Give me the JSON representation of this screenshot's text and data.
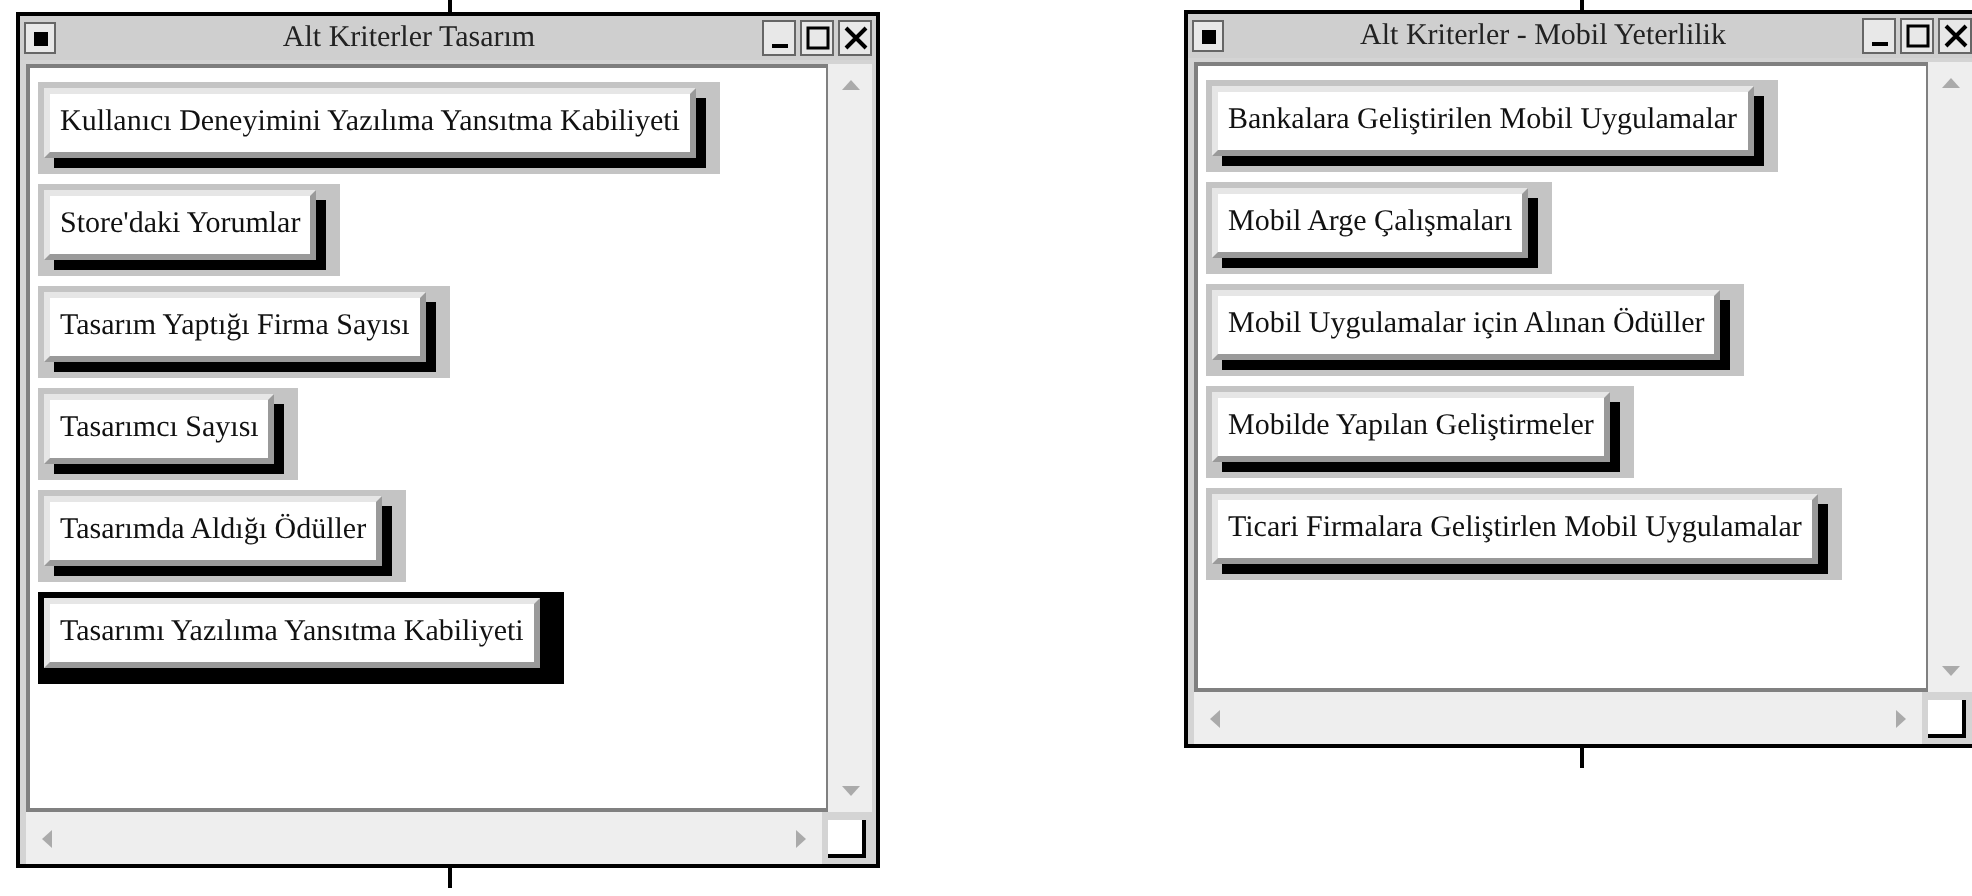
{
  "windows": [
    {
      "title": "Alt Kriterler Tasarım",
      "items": [
        {
          "label": "Kullanıcı Deneyimini Yazılıma Yansıtma Kabiliyeti",
          "selected": false
        },
        {
          "label": "Store'daki Yorumlar",
          "selected": false
        },
        {
          "label": "Tasarım Yaptığı Firma Sayısı",
          "selected": false
        },
        {
          "label": "Tasarımcı Sayısı",
          "selected": false
        },
        {
          "label": "Tasarımda Aldığı Ödüller",
          "selected": false
        },
        {
          "label": "Tasarımı Yazılıma Yansıtma Kabiliyeti",
          "selected": true
        }
      ]
    },
    {
      "title": "Alt Kriterler - Mobil Yeterlilik",
      "items": [
        {
          "label": "Bankalara Geliştirilen Mobil Uygulamalar",
          "selected": false
        },
        {
          "label": "Mobil Arge Çalışmaları",
          "selected": false
        },
        {
          "label": "Mobil Uygulamalar için Alınan Ödüller",
          "selected": false
        },
        {
          "label": "Mobilde Yapılan Geliştirmeler",
          "selected": false
        },
        {
          "label": "Ticari Firmalara Geliştirlen Mobil Uygulamalar",
          "selected": false
        }
      ]
    }
  ]
}
